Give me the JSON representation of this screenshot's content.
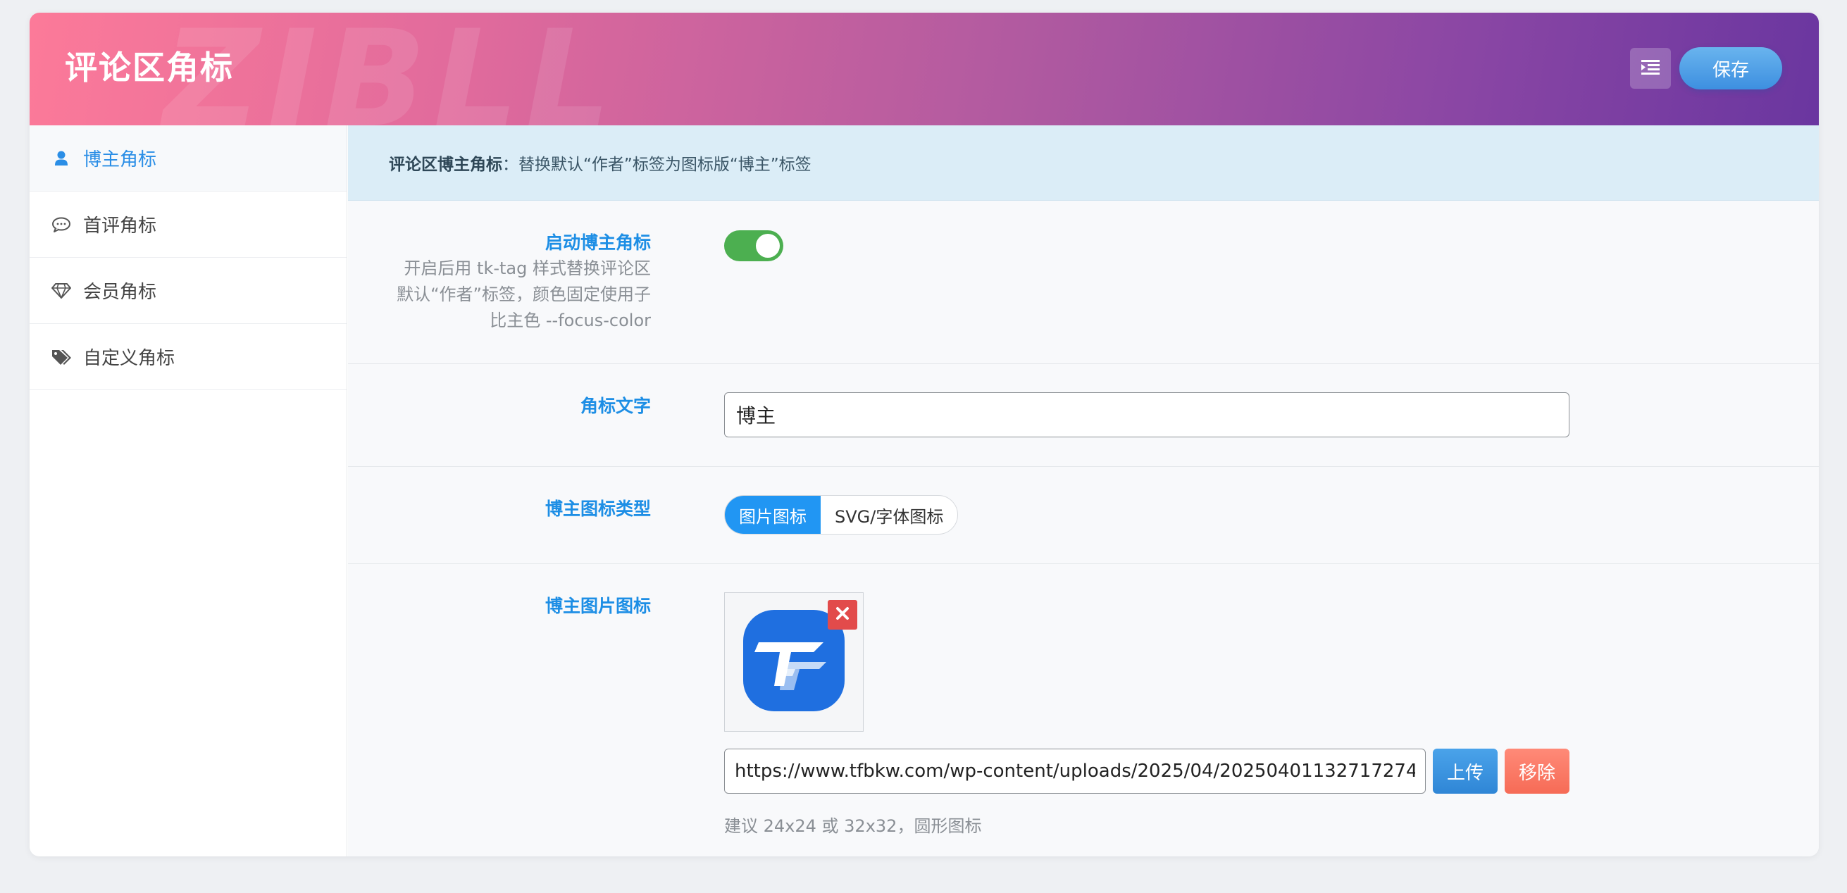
{
  "header": {
    "title": "评论区角标",
    "watermark": "ZIBLL",
    "save_label": "保存",
    "menu_icon": "list-indent-icon"
  },
  "sidebar": {
    "items": [
      {
        "label": "博主角标",
        "icon": "user-icon",
        "active": true
      },
      {
        "label": "首评角标",
        "icon": "comment-icon",
        "active": false
      },
      {
        "label": "会员角标",
        "icon": "diamond-icon",
        "active": false
      },
      {
        "label": "自定义角标",
        "icon": "tags-icon",
        "active": false
      }
    ]
  },
  "notice": {
    "title": "评论区博主角标",
    "separator": "：",
    "text": "替换默认“作者”标签为图标版“博主”标签"
  },
  "fields": {
    "enable": {
      "label": "启动博主角标",
      "desc_lines": [
        "开启后用 tk-tag 样式替换评论区",
        "默认“作者”标签，颜色固定使用子",
        "比主色 --focus-color"
      ],
      "enabled": true
    },
    "badge_text": {
      "label": "角标文字",
      "value": "博主"
    },
    "icon_type": {
      "label": "博主图标类型",
      "options": [
        "图片图标",
        "SVG/字体图标"
      ],
      "selected": "图片图标"
    },
    "image_icon": {
      "label": "博主图片图标",
      "url": "https://www.tfbkw.com/wp-content/uploads/2025/04/20250401132717274",
      "upload_label": "上传",
      "remove_label": "移除",
      "hint": "建议 24x24 或 32x32，圆形图标"
    }
  },
  "colors": {
    "accent": "#1d8ee5",
    "toggle_on": "#4caf50",
    "notice_bg": "#dbedf7",
    "remove": "#f66b56",
    "logo_blue": "#1f6fe0"
  }
}
